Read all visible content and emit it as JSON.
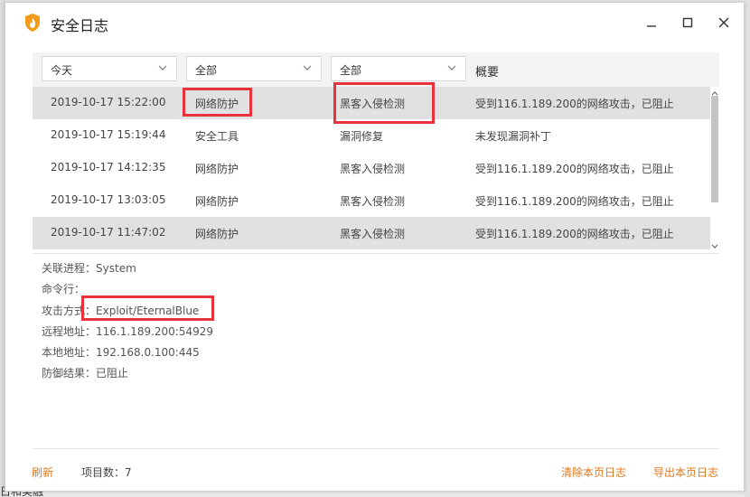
{
  "window": {
    "title": "安全日志"
  },
  "filters": {
    "date": "今天",
    "category": "全部",
    "type": "全部",
    "summary_header": "概要"
  },
  "rows": [
    {
      "time": "2019-10-17 15:22:00",
      "category": "网络防护",
      "type": "黑客入侵检测",
      "summary": "受到116.1.189.200的网络攻击，已阻止",
      "selected": true
    },
    {
      "time": "2019-10-17 15:19:44",
      "category": "安全工具",
      "type": "漏洞修复",
      "summary": "未发现漏洞补丁",
      "selected": false
    },
    {
      "time": "2019-10-17 14:12:35",
      "category": "网络防护",
      "type": "黑客入侵检测",
      "summary": "受到116.1.189.200的网络攻击，已阻止",
      "selected": false
    },
    {
      "time": "2019-10-17 13:03:05",
      "category": "网络防护",
      "type": "黑客入侵检测",
      "summary": "受到116.1.189.200的网络攻击，已阻止",
      "selected": false
    },
    {
      "time": "2019-10-17 11:47:02",
      "category": "网络防护",
      "type": "黑客入侵检测",
      "summary": "受到116.1.189.200的网络攻击，已阻止",
      "selected": false
    }
  ],
  "details": {
    "process": {
      "label": "关联进程：",
      "value": "System"
    },
    "cmdline": {
      "label": "命令行：",
      "value": ""
    },
    "attack": {
      "label": "攻击方式：",
      "value": "Exploit/EternalBlue"
    },
    "remote": {
      "label": "远程地址：",
      "value": "116.1.189.200:54929"
    },
    "local": {
      "label": "本地地址：",
      "value": "192.168.0.100:445"
    },
    "result": {
      "label": "防御结果：",
      "value": "已阻止"
    }
  },
  "footer": {
    "refresh": "刷新",
    "count_label": "项目数：",
    "count_value": "7",
    "clear": "清除本页日志",
    "export": "导出本页日志"
  },
  "background": {
    "bottom_left_text": "日和美融"
  },
  "colors": {
    "accent_orange": "#e07a1f",
    "highlight_red": "#e8323c",
    "selected_row": "#e1e1e1",
    "logo_orange": "#f29a1c"
  },
  "icons": {
    "logo": "shield-flame-icon",
    "minimize": "minimize-icon",
    "maximize": "maximize-icon",
    "close": "close-icon",
    "dropdown": "chevron-down-icon"
  }
}
